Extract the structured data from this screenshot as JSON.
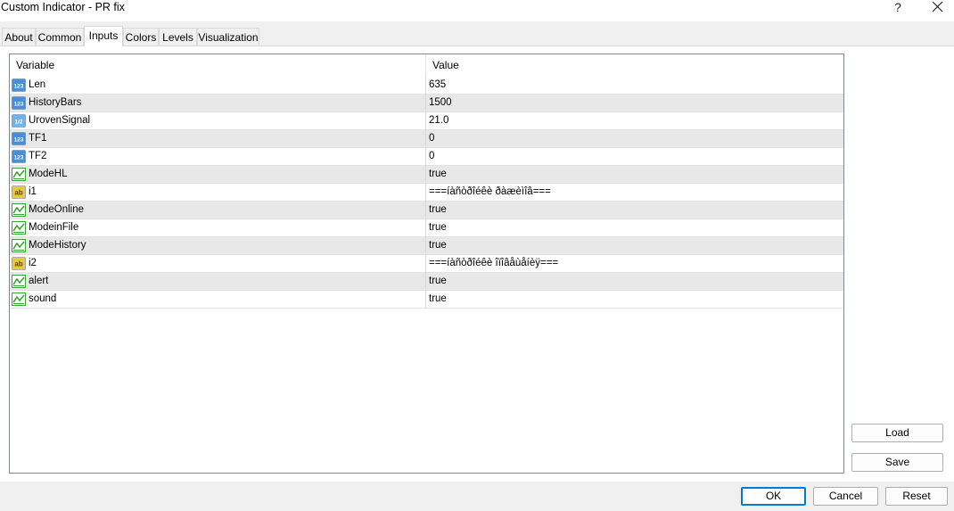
{
  "window": {
    "title": "Custom Indicator - PR fix",
    "help_label": "?"
  },
  "tabs": [
    {
      "label": "About"
    },
    {
      "label": "Common"
    },
    {
      "label": "Inputs"
    },
    {
      "label": "Colors"
    },
    {
      "label": "Levels"
    },
    {
      "label": "Visualization"
    }
  ],
  "active_tab": "Inputs",
  "grid": {
    "columns": [
      "Variable",
      "Value"
    ],
    "rows": [
      {
        "icon": "integer-icon",
        "variable": "Len",
        "value": "635"
      },
      {
        "icon": "integer-icon",
        "variable": "HistoryBars",
        "value": "1500"
      },
      {
        "icon": "double-icon",
        "variable": "UrovenSignal",
        "value": "21.0"
      },
      {
        "icon": "integer-icon",
        "variable": "TF1",
        "value": "0"
      },
      {
        "icon": "integer-icon",
        "variable": "TF2",
        "value": "0"
      },
      {
        "icon": "bool-icon",
        "variable": "ModeHL",
        "value": "true"
      },
      {
        "icon": "string-icon",
        "variable": "i1",
        "value": "===íàñòðîéêè ðàæèìîâ==="
      },
      {
        "icon": "bool-icon",
        "variable": "ModeOnline",
        "value": "true"
      },
      {
        "icon": "bool-icon",
        "variable": "ModeinFile",
        "value": "true"
      },
      {
        "icon": "bool-icon",
        "variable": "ModeHistory",
        "value": "true"
      },
      {
        "icon": "string-icon",
        "variable": "i2",
        "value": "===íàñòðîéêè îïîâåùåíèÿ==="
      },
      {
        "icon": "bool-icon",
        "variable": "alert",
        "value": "true"
      },
      {
        "icon": "bool-icon",
        "variable": "sound",
        "value": "true"
      }
    ]
  },
  "side_buttons": {
    "load": "Load",
    "save": "Save"
  },
  "footer_buttons": {
    "ok": "OK",
    "cancel": "Cancel",
    "reset": "Reset"
  },
  "icon_glyphs": {
    "integer": "123",
    "double": "1/2",
    "string": "ab"
  },
  "colors": {
    "row_alt": "#e8e8e8",
    "default_button_border": "#0078d7",
    "integer_icon": "#4a8fd4",
    "double_icon": "#6fb6e8",
    "string_icon": "#e6c94a",
    "bool_icon": "#3ca53c"
  }
}
